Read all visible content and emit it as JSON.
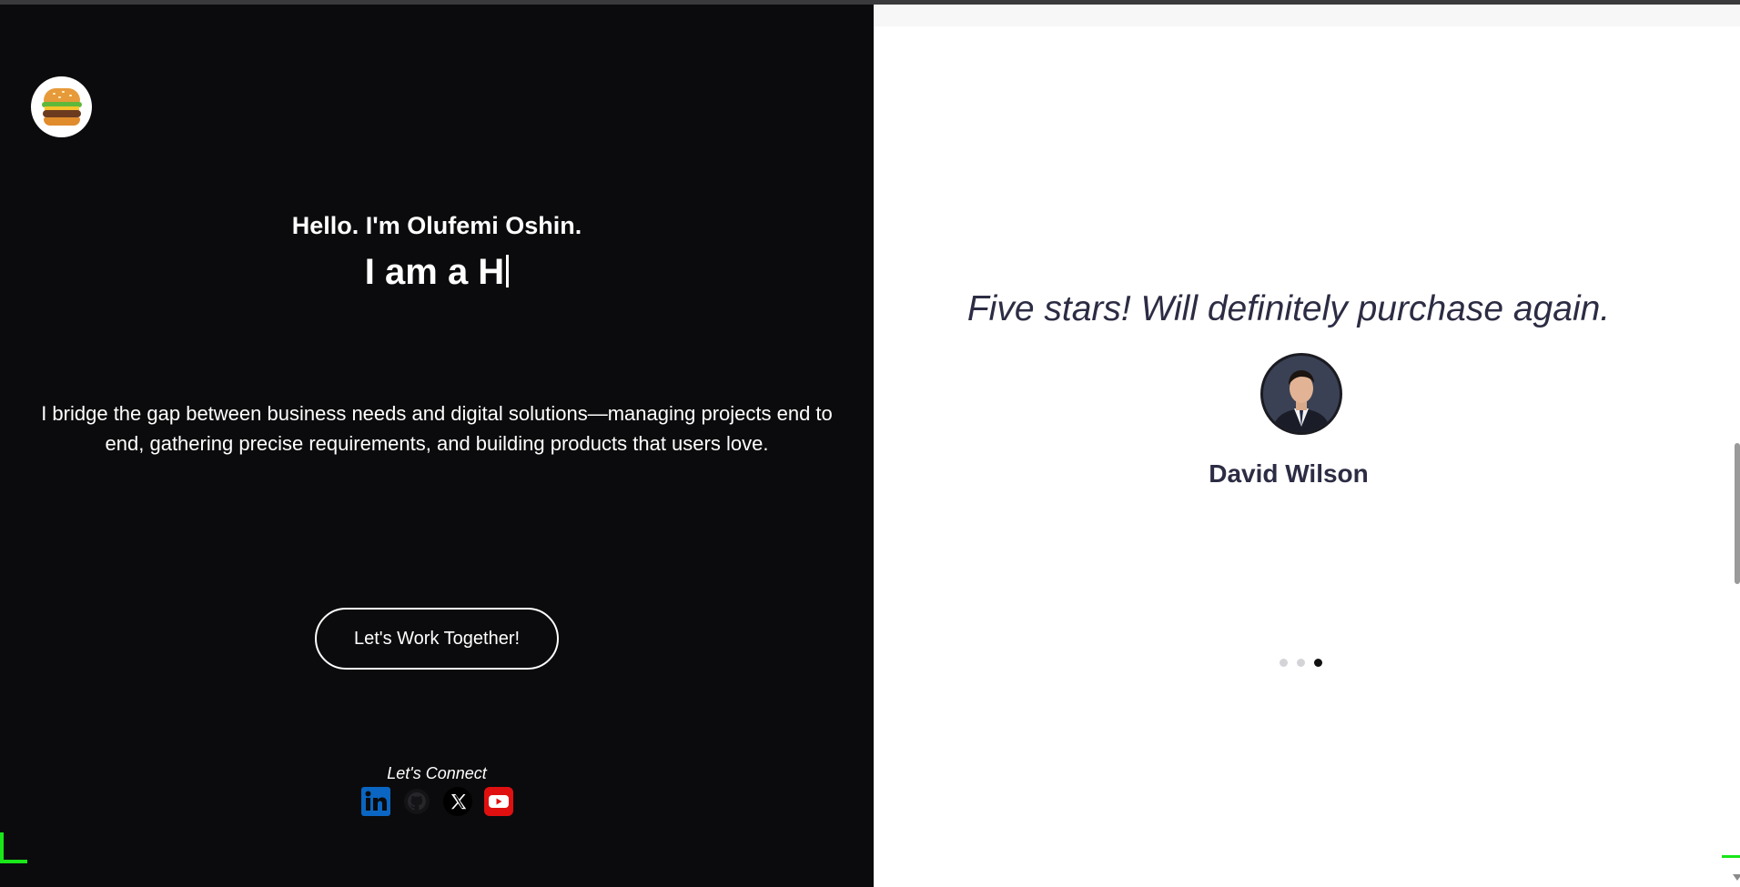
{
  "header": {
    "menu_icon": "burger-icon"
  },
  "hero": {
    "greeting": "Hello. I'm Olufemi Oshin.",
    "typed_text": "I am a H",
    "bio": "I bridge the gap between business needs and digital solutions—managing projects end to end, gathering precise requirements, and building products that users love.",
    "cta_label": "Let's Work Together!",
    "connect_label": "Let's Connect",
    "socials": [
      "linkedin-icon",
      "github-icon",
      "x-icon",
      "youtube-icon"
    ]
  },
  "testimonial": {
    "quote": "Five stars! Will definitely purchase again.",
    "author": "David Wilson",
    "pager": {
      "total": 3,
      "active": 3
    }
  },
  "colors": {
    "left_bg": "#0b0b0d",
    "right_bg": "#ffffff",
    "text_dark": "#2c2c44",
    "accent_green": "#19e619",
    "linkedin": "#0a66c2",
    "youtube": "#ff0000"
  }
}
